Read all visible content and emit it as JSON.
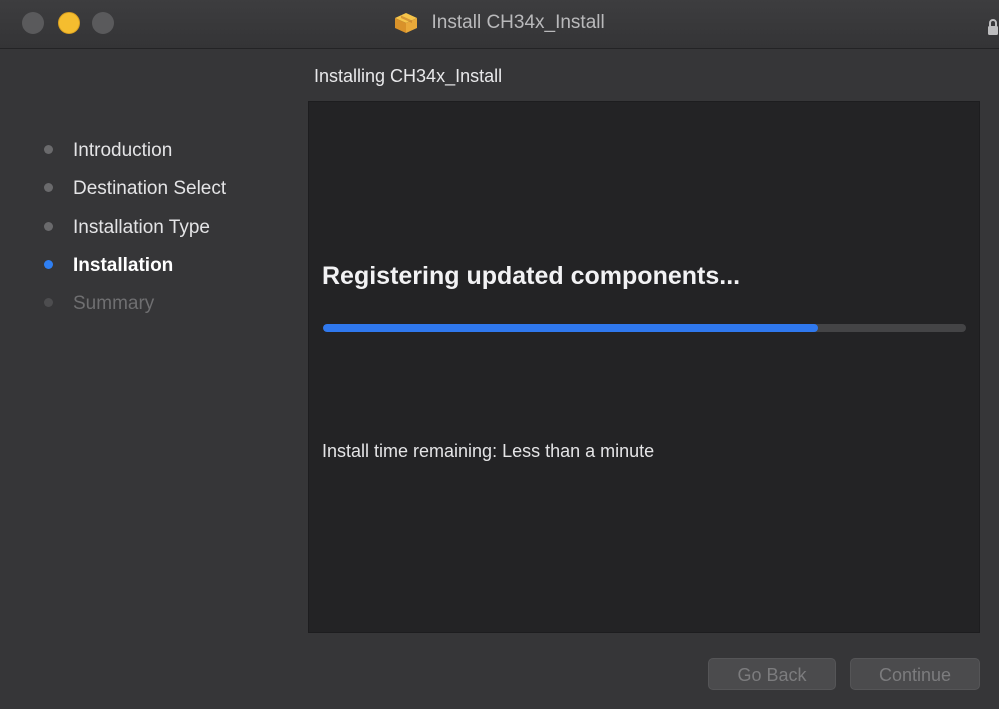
{
  "window": {
    "title": "Install CH34x_Install"
  },
  "sidebar": {
    "steps": [
      {
        "label": "Introduction",
        "state": "done"
      },
      {
        "label": "Destination Select",
        "state": "done"
      },
      {
        "label": "Installation Type",
        "state": "done"
      },
      {
        "label": "Installation",
        "state": "active"
      },
      {
        "label": "Summary",
        "state": "disabled"
      }
    ]
  },
  "main": {
    "heading": "Installing CH34x_Install",
    "status": "Registering updated components...",
    "progress_percent": 77,
    "time_remaining": "Install time remaining: Less than a minute"
  },
  "buttons": {
    "go_back": "Go Back",
    "continue": "Continue"
  },
  "colors": {
    "accent": "#2f78ee",
    "minimize": "#f5bd2f"
  }
}
